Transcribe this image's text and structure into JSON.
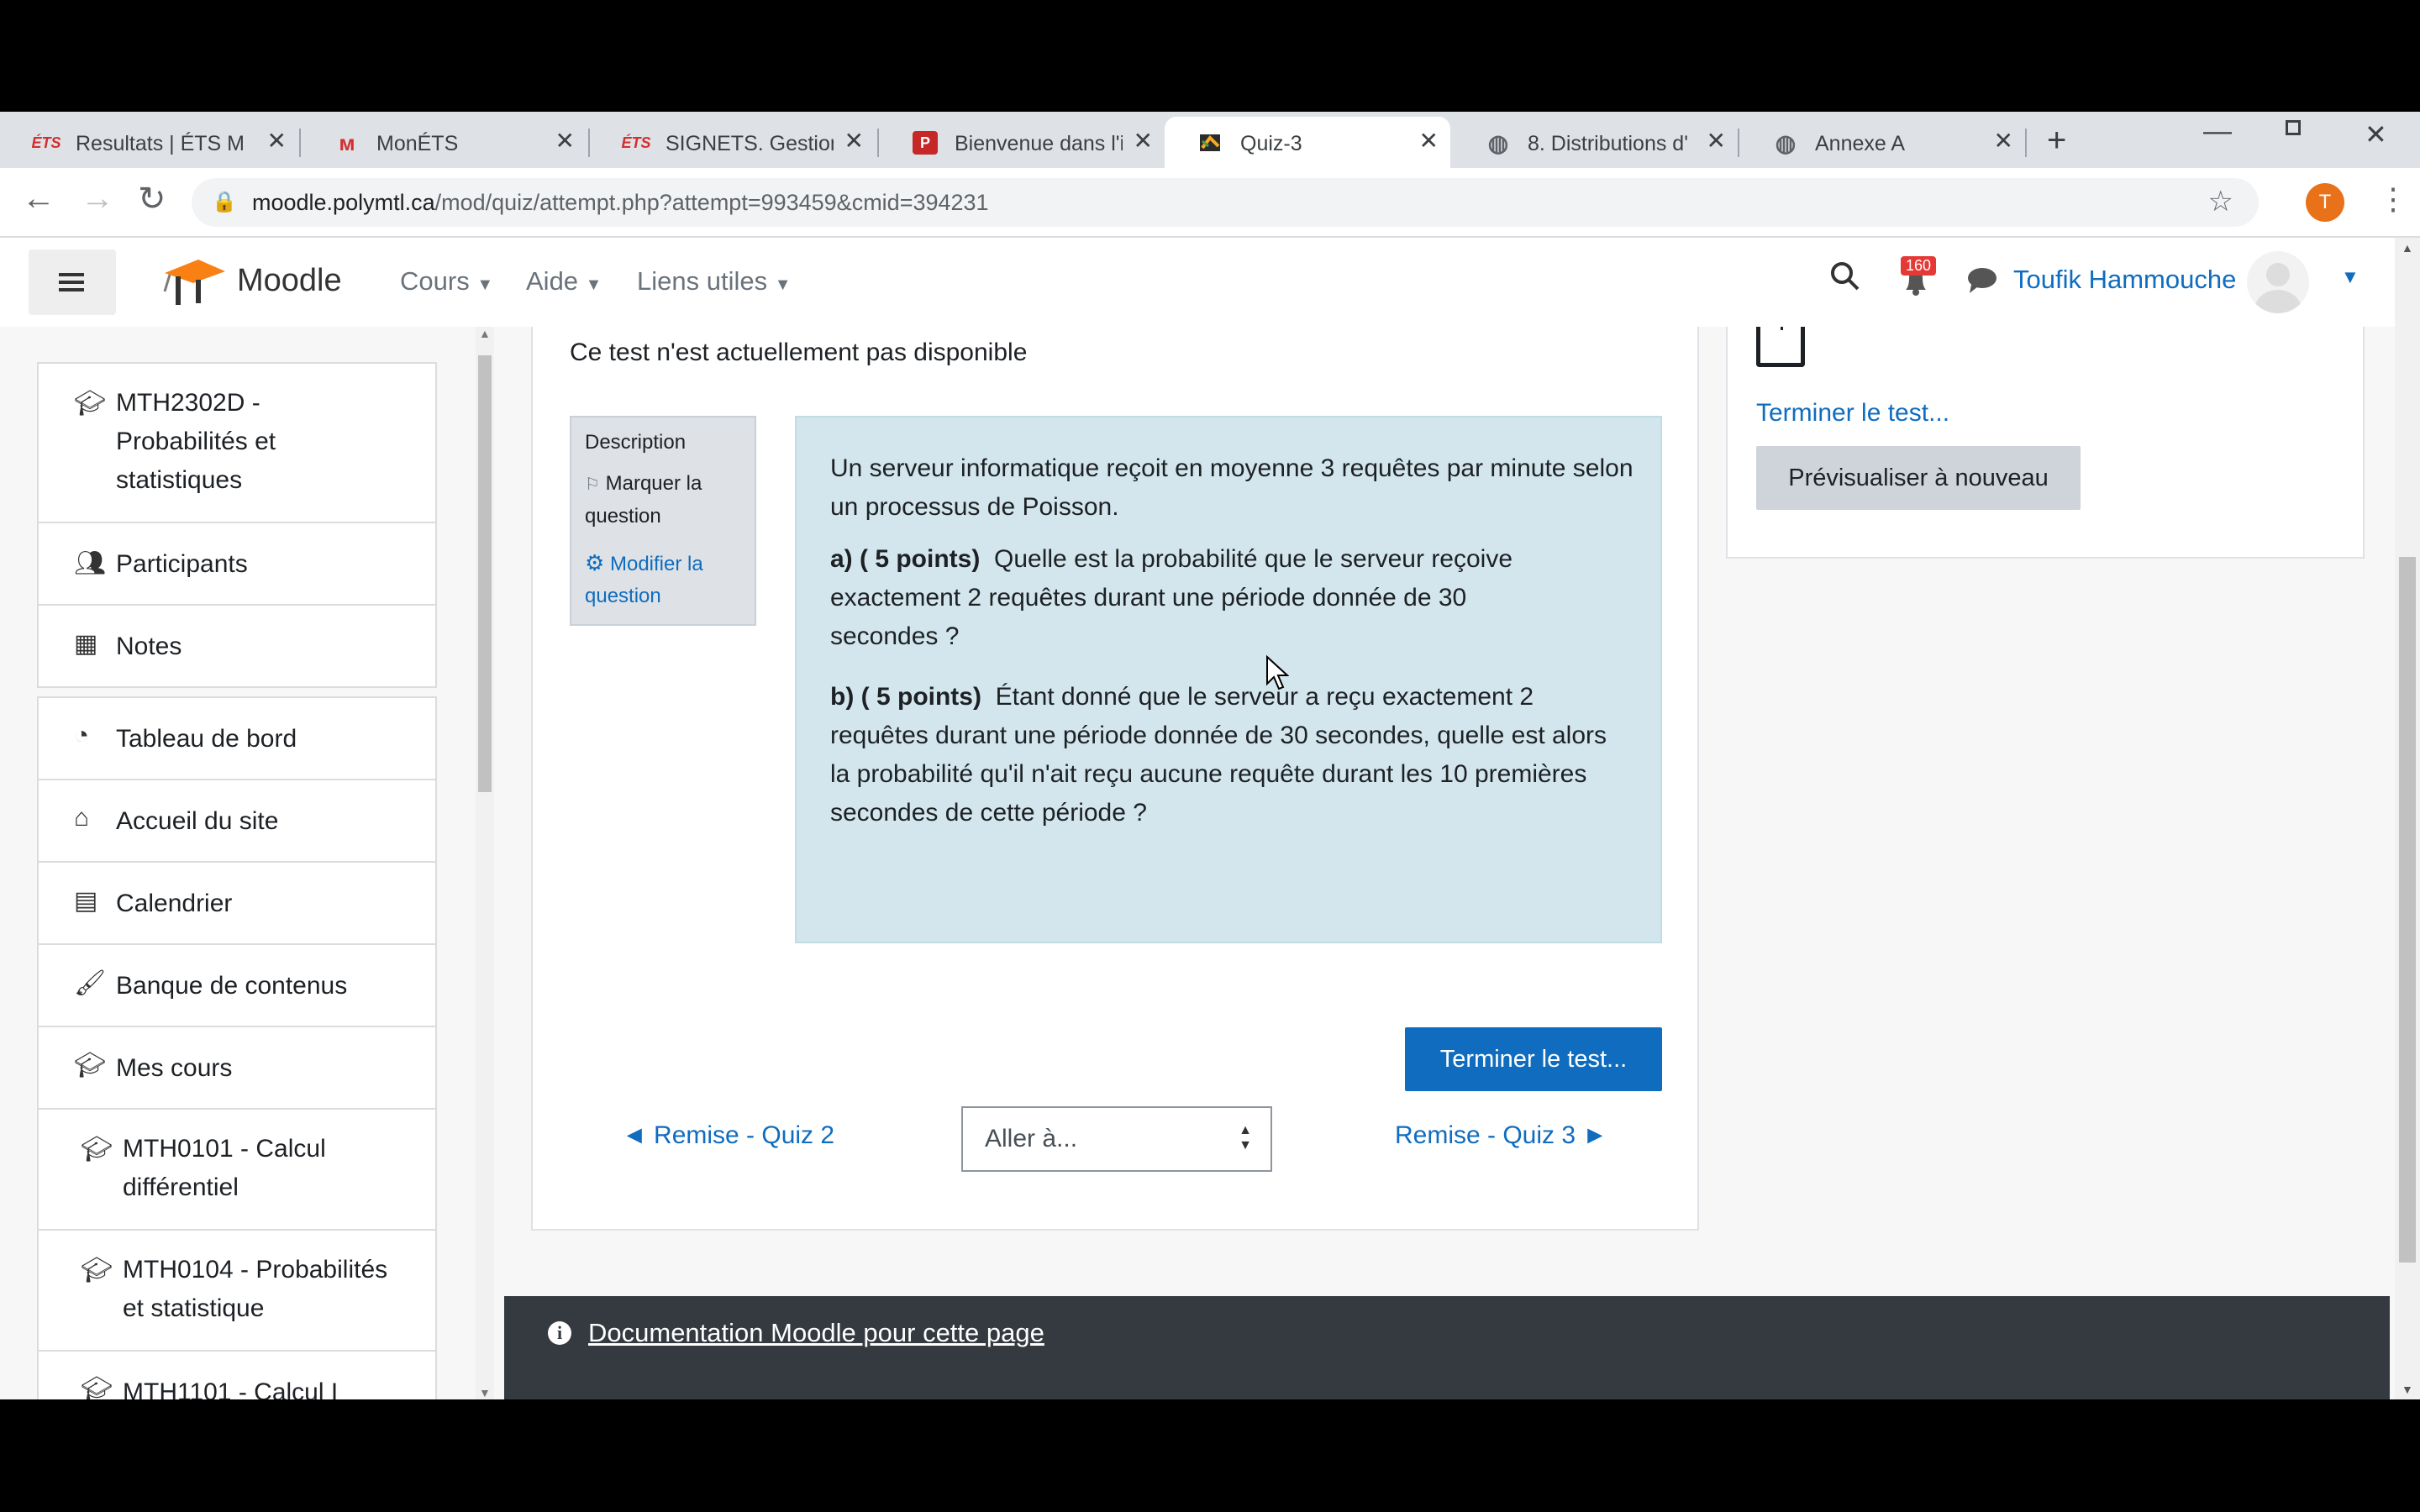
{
  "browser": {
    "tabs": [
      {
        "title": "Resultats | ÉTS Mo",
        "favicon": "ets-logo",
        "active": false
      },
      {
        "title": "MonÉTS",
        "favicon": "monets-logo",
        "active": false
      },
      {
        "title": "SIGNETS. Gestion",
        "favicon": "ets-logo",
        "active": false
      },
      {
        "title": "Bienvenue dans l'i",
        "favicon": "p-logo",
        "active": false
      },
      {
        "title": "Quiz-3",
        "favicon": "moodle-logo",
        "active": true
      },
      {
        "title": "8. Distributions d'",
        "favicon": "globe-icon",
        "active": false
      },
      {
        "title": "Annexe A",
        "favicon": "globe-icon",
        "active": false
      }
    ],
    "url_domain": "moodle.polymtl.ca",
    "url_path": "/mod/quiz/attempt.php?attempt=993459&cmid=394231",
    "profile_initial": "T"
  },
  "navbar": {
    "brand": "Moodle",
    "menus": [
      "Cours",
      "Aide",
      "Liens utiles"
    ],
    "notification_count": "160",
    "user_name": "Toufik Hammouche"
  },
  "sidebar": {
    "items": [
      {
        "label": "MTH2302D -\nProbabilités et\nstatistiques",
        "icon": "graduation-cap-icon"
      },
      {
        "label": "Participants",
        "icon": "users-icon"
      },
      {
        "label": "Notes",
        "icon": "table-icon"
      },
      {
        "label": "Tableau de bord",
        "icon": "dashboard-icon"
      },
      {
        "label": "Accueil du site",
        "icon": "home-icon"
      },
      {
        "label": "Calendrier",
        "icon": "calendar-icon"
      },
      {
        "label": "Banque de contenus",
        "icon": "paintbrush-icon"
      },
      {
        "label": "Mes cours",
        "icon": "graduation-cap-icon"
      },
      {
        "label": "MTH0101 - Calcul\ndifférentiel",
        "icon": "graduation-cap-icon"
      },
      {
        "label": "MTH0104 - Probabilités\net statistique",
        "icon": "graduation-cap-icon"
      },
      {
        "label": "MTH1101 - Calcul I",
        "icon": "graduation-cap-icon"
      }
    ]
  },
  "quiz": {
    "unavailable_notice": "Ce test n'est actuellement pas disponible",
    "info_box": {
      "title": "Description",
      "flag_label": "Marquer la\nquestion",
      "edit_label": "Modifier la\nquestion"
    },
    "intro": "Un serveur informatique reçoit en moyenne 3 requêtes par minute selon un processus de Poisson.",
    "part_a_prefix": "a) ( 5 points)",
    "part_a_text": "Quelle est la probabilité que le serveur reçoive exactement 2 requêtes durant une période donnée de 30 secondes ?",
    "part_b_prefix": "b) ( 5 points)",
    "part_b_text": "Étant donné que le serveur a reçu exactement 2 requêtes durant une période donnée de 30 secondes, quelle est alors la probabilité qu'il n'ait reçu aucune requête durant les 10 premières secondes de cette période ?",
    "finish_button": "Terminer le test...",
    "prev_link": "◄ Remise - Quiz 2",
    "jump_select": "Aller à...",
    "next_link": "Remise - Quiz 3 ►"
  },
  "quiz_nav_block": {
    "finish_link": "Terminer le test...",
    "preview_again_button": "Prévisualiser à nouveau"
  },
  "footer": {
    "doc_link": "Documentation Moodle pour cette page"
  },
  "colors": {
    "link": "#0f6cbf",
    "primary_button": "#0f6cbf",
    "question_bg": "#d3e6ed",
    "badge": "#e53935",
    "footer_bg": "#343a40"
  }
}
